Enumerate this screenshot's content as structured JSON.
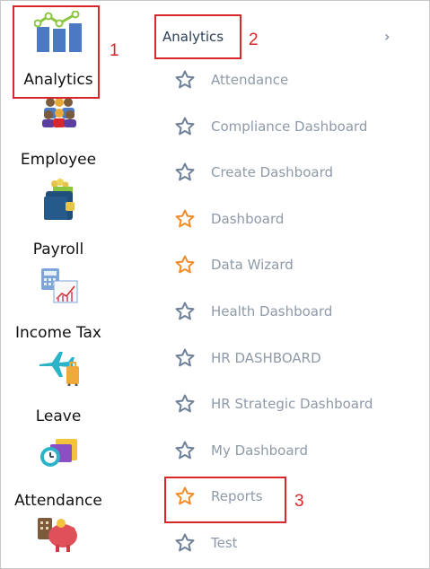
{
  "modules": [
    {
      "label": "Analytics",
      "icon": "analytics-icon"
    },
    {
      "label": "Employee",
      "icon": "employee-icon"
    },
    {
      "label": "Payroll",
      "icon": "payroll-icon"
    },
    {
      "label": "Income Tax",
      "icon": "income-tax-icon"
    },
    {
      "label": "Leave",
      "icon": "leave-icon"
    },
    {
      "label": "Attendance",
      "icon": "attendance-icon"
    }
  ],
  "submenu": {
    "title": "Analytics",
    "expand_icon": "chevron-right-icon",
    "items": [
      {
        "label": "Attendance",
        "favorite": false
      },
      {
        "label": "Compliance Dashboard",
        "favorite": false
      },
      {
        "label": "Create Dashboard",
        "favorite": false
      },
      {
        "label": "Dashboard",
        "favorite": true
      },
      {
        "label": "Data Wizard",
        "favorite": true
      },
      {
        "label": "Health Dashboard",
        "favorite": false
      },
      {
        "label": "HR DASHBOARD",
        "favorite": false
      },
      {
        "label": "HR Strategic Dashboard",
        "favorite": false
      },
      {
        "label": "My Dashboard",
        "favorite": false
      },
      {
        "label": "Reports",
        "favorite": true
      },
      {
        "label": "Test",
        "favorite": false
      }
    ]
  },
  "annotations": [
    "1",
    "2",
    "3"
  ],
  "colors": {
    "annotation": "#d9262b",
    "star_favorite": "#f28c28",
    "star_default": "#6f8199",
    "menu_text": "#8e9aa8",
    "title_text": "#2c3e56"
  }
}
